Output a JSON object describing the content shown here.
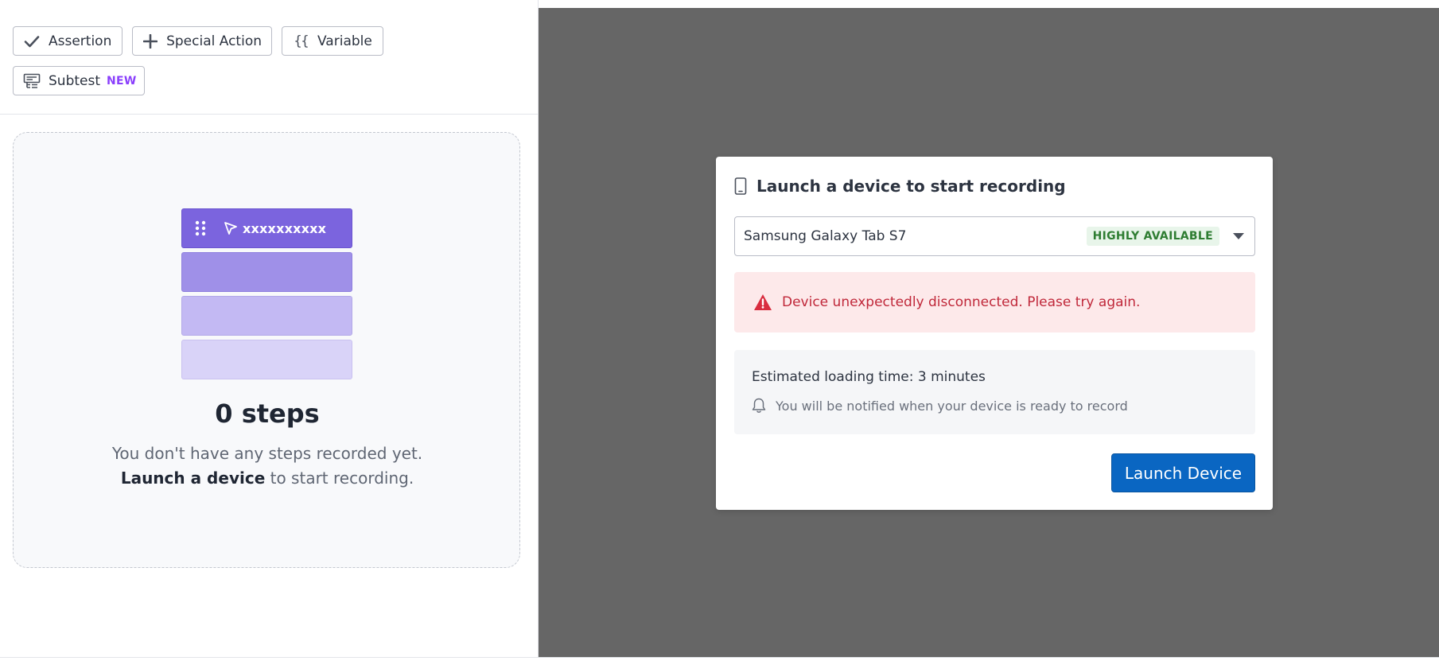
{
  "toolbar": {
    "assertion_label": "Assertion",
    "special_action_label": "Special Action",
    "variable_label": "Variable",
    "variable_icon_text": "{{",
    "subtest_label": "Subtest",
    "subtest_badge": "NEW"
  },
  "empty_state": {
    "step_placeholder": "xxxxxxxxxx",
    "steps_count": "0 steps",
    "line1": "You don't have any steps recorded yet.",
    "line2_bold": "Launch a device",
    "line2_rest": " to start recording."
  },
  "modal": {
    "title": "Launch a device to start recording",
    "device_selected": "Samsung Galaxy Tab S7",
    "device_badge": "HIGHLY AVAILABLE",
    "error_message": "Device unexpectedly disconnected. Please try again.",
    "estimated_loading": "Estimated loading time: 3 minutes",
    "notify_message": "You will be notified when your device is ready to record",
    "launch_button": "Launch Device"
  },
  "colors": {
    "primary_button": "#0a66c2",
    "step_accent": "#7b64de",
    "error_text": "#c0283a",
    "error_bg": "#fde9ea",
    "badge_green": "#2e7d32",
    "new_purple": "#8a3ffc",
    "overlay_gray": "#666666"
  },
  "icons": {
    "assertion": "check-icon",
    "special_action": "plus-icon",
    "variable": "curly-braces-icon",
    "subtest": "subtest-icon",
    "drag": "drag-handle-icon",
    "cursor": "cursor-icon",
    "device": "mobile-device-icon",
    "dropdown": "chevron-down-icon",
    "warning": "warning-triangle-icon",
    "bell": "bell-icon"
  }
}
